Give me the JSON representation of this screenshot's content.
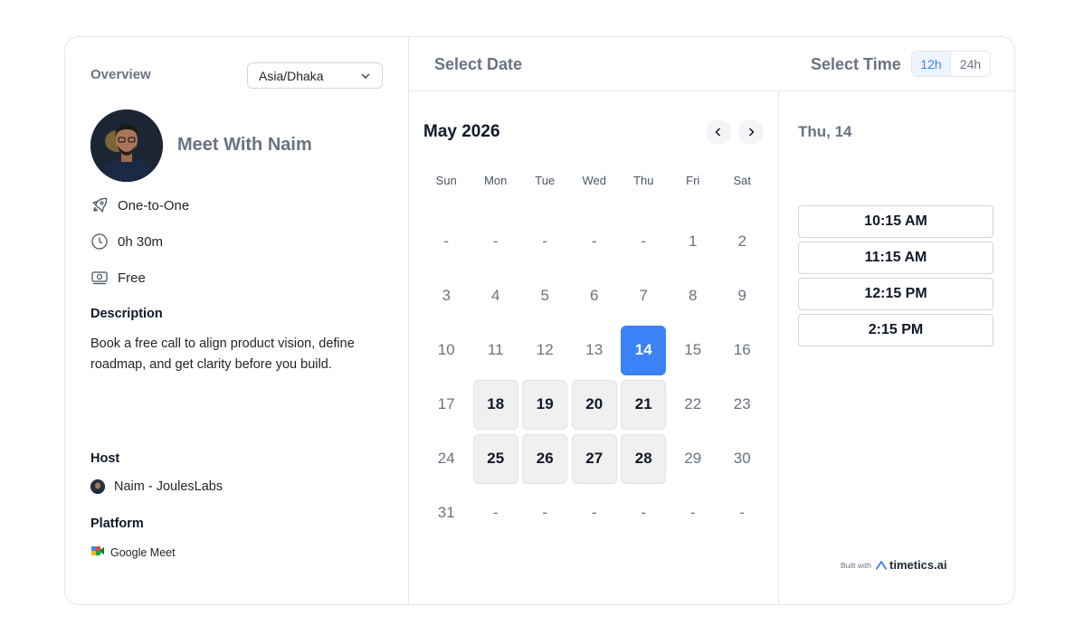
{
  "left": {
    "overview_label": "Overview",
    "timezone": "Asia/Dhaka",
    "meeting_title": "Meet With Naim",
    "meeting_type": "One-to-One",
    "duration": "0h 30m",
    "price": "Free",
    "description_label": "Description",
    "description": "Book a free call to align product vision, define roadmap, and get clarity before you build.",
    "host_label": "Host",
    "host_name": "Naim - JoulesLabs",
    "platform_label": "Platform",
    "platform_name": "Google Meet"
  },
  "header": {
    "select_date": "Select Date",
    "select_time": "Select Time",
    "format_12h": "12h",
    "format_24h": "24h",
    "active_format": "12h"
  },
  "calendar": {
    "month_title": "May 2026",
    "weekdays": [
      "Sun",
      "Mon",
      "Tue",
      "Wed",
      "Thu",
      "Fri",
      "Sat"
    ],
    "days": [
      {
        "label": "-",
        "state": "empty"
      },
      {
        "label": "-",
        "state": "empty"
      },
      {
        "label": "-",
        "state": "empty"
      },
      {
        "label": "-",
        "state": "empty"
      },
      {
        "label": "-",
        "state": "empty"
      },
      {
        "label": "1",
        "state": "disabled"
      },
      {
        "label": "2",
        "state": "disabled"
      },
      {
        "label": "3",
        "state": "disabled"
      },
      {
        "label": "4",
        "state": "disabled"
      },
      {
        "label": "5",
        "state": "disabled"
      },
      {
        "label": "6",
        "state": "disabled"
      },
      {
        "label": "7",
        "state": "disabled"
      },
      {
        "label": "8",
        "state": "disabled"
      },
      {
        "label": "9",
        "state": "disabled"
      },
      {
        "label": "10",
        "state": "disabled"
      },
      {
        "label": "11",
        "state": "disabled"
      },
      {
        "label": "12",
        "state": "disabled"
      },
      {
        "label": "13",
        "state": "disabled"
      },
      {
        "label": "14",
        "state": "selected"
      },
      {
        "label": "15",
        "state": "disabled"
      },
      {
        "label": "16",
        "state": "disabled"
      },
      {
        "label": "17",
        "state": "disabled"
      },
      {
        "label": "18",
        "state": "available"
      },
      {
        "label": "19",
        "state": "available"
      },
      {
        "label": "20",
        "state": "available"
      },
      {
        "label": "21",
        "state": "available"
      },
      {
        "label": "22",
        "state": "disabled"
      },
      {
        "label": "23",
        "state": "disabled"
      },
      {
        "label": "24",
        "state": "disabled"
      },
      {
        "label": "25",
        "state": "available"
      },
      {
        "label": "26",
        "state": "available"
      },
      {
        "label": "27",
        "state": "available"
      },
      {
        "label": "28",
        "state": "available"
      },
      {
        "label": "29",
        "state": "disabled"
      },
      {
        "label": "30",
        "state": "disabled"
      },
      {
        "label": "31",
        "state": "disabled"
      },
      {
        "label": "-",
        "state": "empty"
      },
      {
        "label": "-",
        "state": "empty"
      },
      {
        "label": "-",
        "state": "empty"
      },
      {
        "label": "-",
        "state": "empty"
      },
      {
        "label": "-",
        "state": "empty"
      },
      {
        "label": "-",
        "state": "empty"
      }
    ]
  },
  "times": {
    "selected_date": "Thu, 14",
    "slots": [
      "10:15 AM",
      "11:15 AM",
      "12:15 PM",
      "2:15 PM"
    ],
    "built_with": "Built with",
    "brand": "timetics.ai"
  },
  "colors": {
    "accent": "#3b82f6",
    "muted_text": "#6b7280",
    "available_bg": "#f0f0f0"
  }
}
